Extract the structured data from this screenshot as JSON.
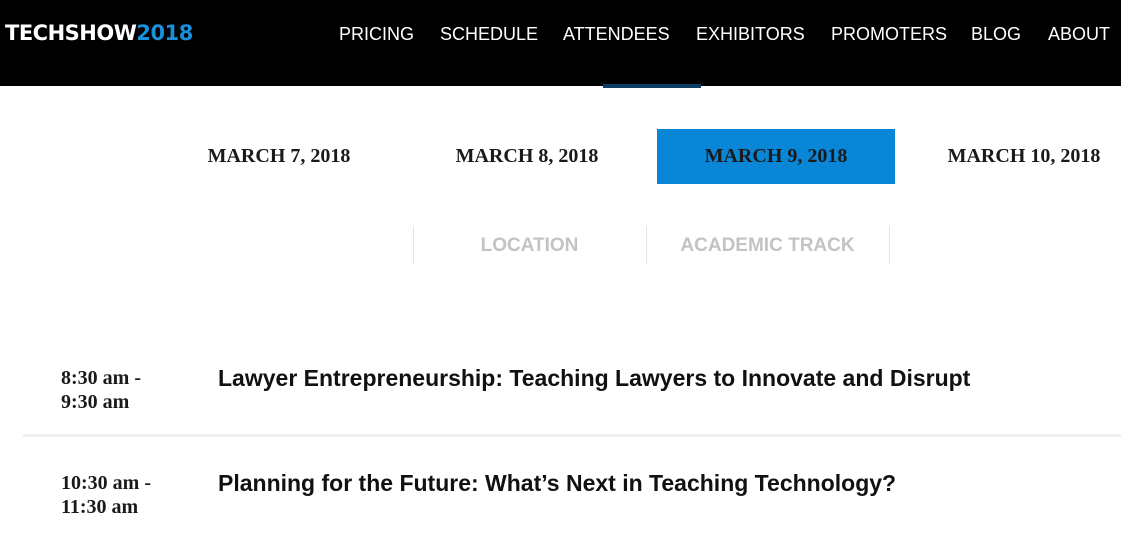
{
  "header": {
    "logo_word": "TECHSHOW",
    "logo_year": "2018",
    "nav": [
      {
        "label": "PRICING"
      },
      {
        "label": "SCHEDULE"
      },
      {
        "label": "ATTENDEES"
      },
      {
        "label": "EXHIBITORS"
      },
      {
        "label": "PROMOTERS"
      },
      {
        "label": "BLOG"
      },
      {
        "label": "ABOUT"
      }
    ]
  },
  "date_tabs": [
    {
      "label": "MARCH 7, 2018",
      "active": false
    },
    {
      "label": "MARCH 8, 2018",
      "active": false
    },
    {
      "label": "MARCH 9, 2018",
      "active": true
    },
    {
      "label": "MARCH 10, 2018",
      "active": false
    }
  ],
  "filters": [
    {
      "label": "LOCATION"
    },
    {
      "label": "ACADEMIC TRACK"
    }
  ],
  "sessions": [
    {
      "time_start": "8:30 am -",
      "time_end": "9:30 am",
      "title": "Lawyer Entrepreneurship: Teaching Lawyers to Innovate and Disrupt"
    },
    {
      "time_start": "10:30 am -",
      "time_end": "11:30 am",
      "title": "Planning for the Future: What’s Next in Teaching Technology?"
    }
  ],
  "colors": {
    "header_bg": "#000000",
    "accent": "#0a86d6",
    "logo_year": "#1a8fdc",
    "filter_text": "#c3c3c3"
  }
}
